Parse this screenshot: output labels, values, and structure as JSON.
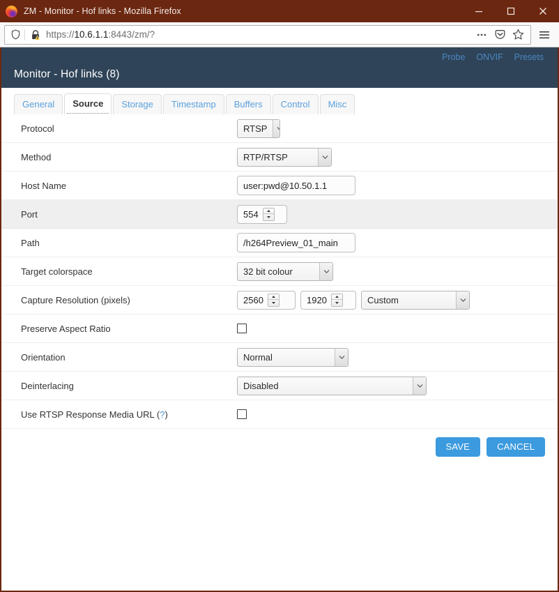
{
  "window": {
    "title": "ZM - Monitor - Hof links - Mozilla Firefox",
    "logo_icon": "firefox-logo",
    "controls": {
      "minimize": "minimize-icon",
      "maximize": "maximize-icon",
      "close": "close-icon"
    },
    "titlebar_color": "#6b2710"
  },
  "navbar": {
    "identity_icon": "shield-icon",
    "security_icon": "lock-warning-icon",
    "url_scheme": "https://",
    "url_host": "10.6.1.1",
    "url_rest": ":8443/zm/?",
    "url_full": "https://10.6.1.1:8443/zm/?",
    "actions": {
      "page_actions": "ellipsis-icon",
      "pocket": "pocket-icon",
      "bookmark": "star-icon",
      "menu": "hamburger-menu-icon"
    }
  },
  "app": {
    "header": {
      "title": "Monitor - Hof links (8)",
      "background_color": "#2f4458",
      "links": [
        {
          "label": "Probe",
          "name": "probe-link"
        },
        {
          "label": "ONVIF",
          "name": "onvif-link"
        },
        {
          "label": "Presets",
          "name": "presets-link"
        }
      ],
      "link_color": "#4a87c4"
    },
    "tabs": [
      {
        "label": "General",
        "active": false
      },
      {
        "label": "Source",
        "active": true
      },
      {
        "label": "Storage",
        "active": false
      },
      {
        "label": "Timestamp",
        "active": false
      },
      {
        "label": "Buffers",
        "active": false
      },
      {
        "label": "Control",
        "active": false
      },
      {
        "label": "Misc",
        "active": false
      }
    ],
    "form": {
      "protocol": {
        "label": "Protocol",
        "value": "RTSP"
      },
      "method": {
        "label": "Method",
        "value": "RTP/RTSP"
      },
      "host_name": {
        "label": "Host Name",
        "value": "user:pwd@10.50.1.1"
      },
      "port": {
        "label": "Port",
        "value": "554",
        "highlighted": true
      },
      "path": {
        "label": "Path",
        "value": "/h264Preview_01_main"
      },
      "target_colorspace": {
        "label": "Target colorspace",
        "value": "32 bit colour"
      },
      "capture_resolution": {
        "label": "Capture Resolution (pixels)",
        "width": "2560",
        "height": "1920",
        "preset": "Custom"
      },
      "preserve_aspect_ratio": {
        "label": "Preserve Aspect Ratio",
        "checked": false
      },
      "orientation": {
        "label": "Orientation",
        "value": "Normal"
      },
      "deinterlacing": {
        "label": "Deinterlacing",
        "value": "Disabled"
      },
      "use_rtsp_media_url": {
        "label": "Use RTSP Response Media URL",
        "help_open": "(",
        "help_mark": "?",
        "help_close": ")",
        "checked": false
      }
    },
    "buttons": {
      "save": "SAVE",
      "cancel": "CANCEL",
      "accent_color": "#3c9ade"
    }
  }
}
